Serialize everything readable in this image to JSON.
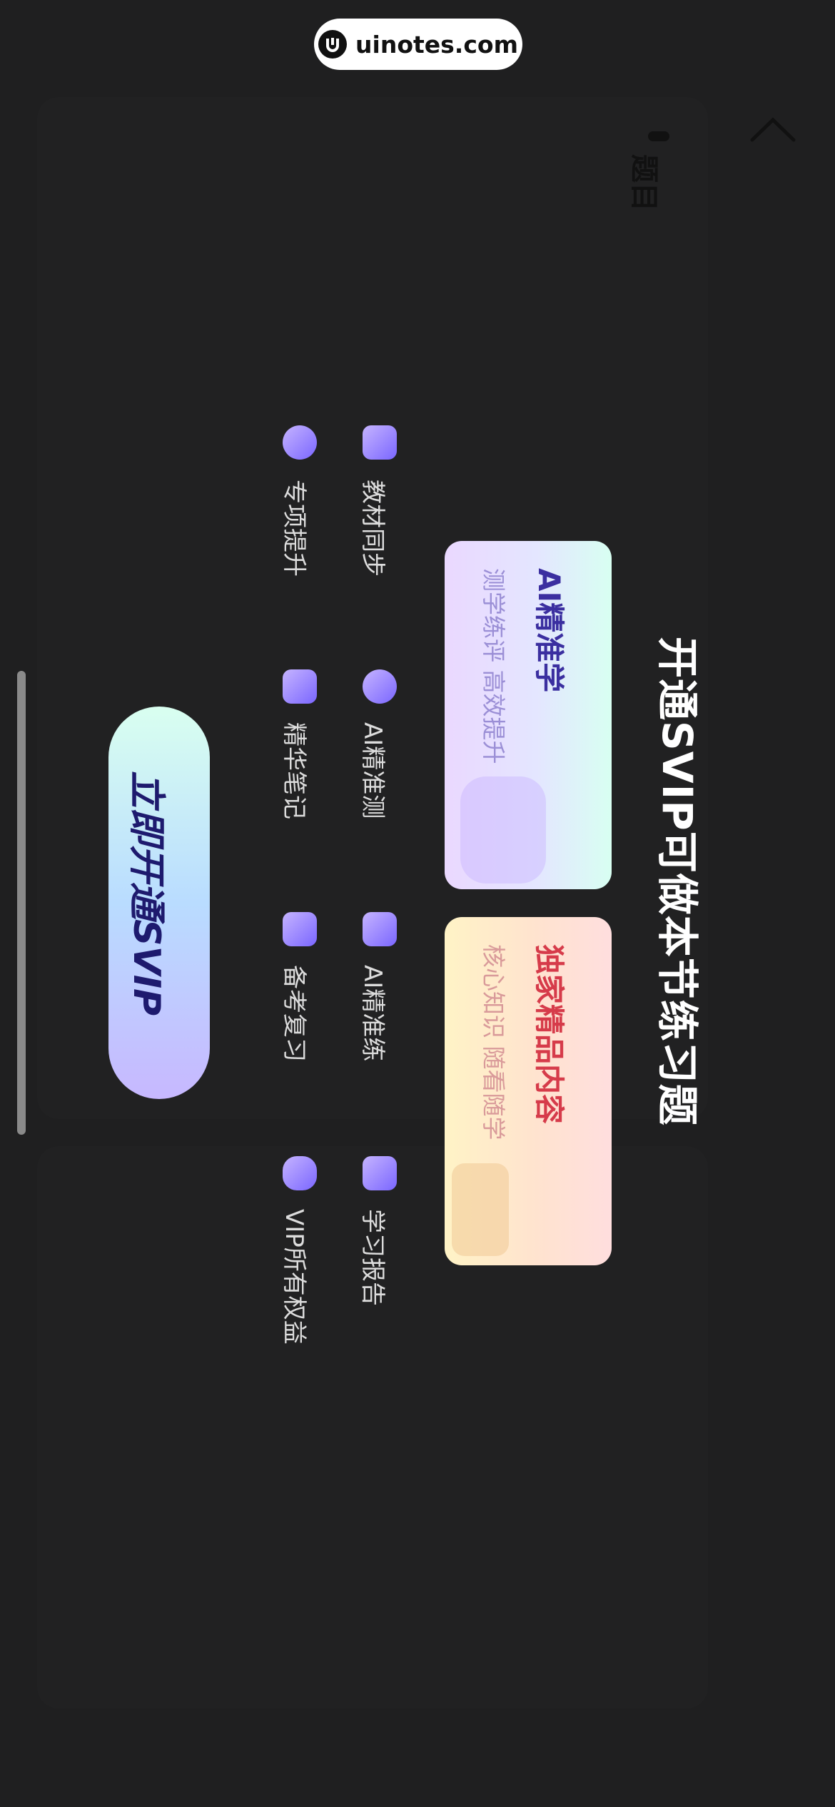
{
  "watermark": {
    "text": "uinotes.com"
  },
  "section": {
    "label": "题目"
  },
  "promo": {
    "title": "开通SVIP可做本节练习题",
    "cards": [
      {
        "title": "AI精准学",
        "subtitle": "测学练评 高效提升",
        "title_color": "#3b2fa0",
        "subtitle_color": "#9b8fd6"
      },
      {
        "title": "独家精品内容",
        "subtitle": "核心知识 随看随学",
        "title_color": "#d63b4a",
        "subtitle_color": "#d99a9a"
      }
    ],
    "features": [
      {
        "label": "教材同步",
        "icon": "book-sync-icon"
      },
      {
        "label": "AI精准测",
        "icon": "ai-test-icon"
      },
      {
        "label": "AI精准练",
        "icon": "ai-practice-icon"
      },
      {
        "label": "学习报告",
        "icon": "report-icon"
      },
      {
        "label": "专项提升",
        "icon": "rocket-icon"
      },
      {
        "label": "精华笔记",
        "icon": "notes-icon"
      },
      {
        "label": "备考复习",
        "icon": "review-icon"
      },
      {
        "label": "VIP所有权益",
        "icon": "vip-icon"
      }
    ],
    "cta": {
      "label": "立即开通SVIP"
    }
  },
  "colors": {
    "accent": "#7a66ff",
    "background": "#1f1f20"
  }
}
